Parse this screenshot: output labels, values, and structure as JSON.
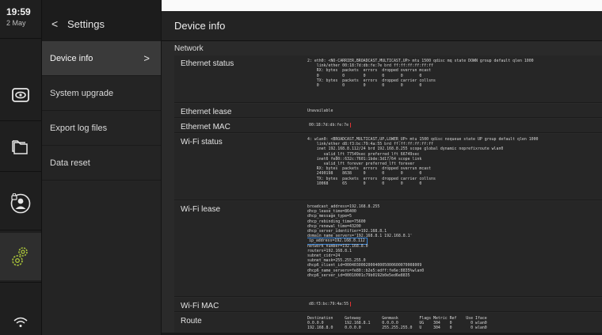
{
  "status": {
    "time": "19:59",
    "date": "2 May"
  },
  "menu": {
    "back_label": "<",
    "title": "Settings",
    "items": [
      {
        "label": "Device info",
        "active": true,
        "chevron": ">"
      },
      {
        "label": "System upgrade"
      },
      {
        "label": "Export log files"
      },
      {
        "label": "Data reset"
      }
    ]
  },
  "main": {
    "title": "Device info",
    "section": "Network",
    "rows": [
      {
        "label": "Ethernet status",
        "lines": [
          "2: eth0: <NO-CARRIER,BROADCAST,MULTICAST,UP> mtu 1500 qdisc mq state DOWN group default qlen 1000",
          "    link/ether 00:18:7d:db:fe:7e brd ff:ff:ff:ff:ff:ff",
          "    RX: bytes  packets  errors  dropped overrun mcast",
          "    0          0        0       0       0       0",
          "    TX: bytes  packets  errors  dropped carrier collsns",
          "    0          0        0       0       0       0"
        ]
      },
      {
        "label": "Ethernet lease",
        "lines": [
          "Unavailable"
        ]
      },
      {
        "label": "Ethernet MAC",
        "lines": [
          "00:18:7d:db:fe:7e"
        ],
        "highlight": "red"
      },
      {
        "label": "Wi-Fi status",
        "lines": [
          "4: wlan0: <BROADCAST,MULTICAST,UP,LOWER_UP> mtu 1500 qdisc noqueue state UP group default qlen 1000",
          "    link/ether d8:f3:bc:79:4a:55 brd ff:ff:ff:ff:ff:ff",
          "    inet 192.168.8.112/24 brd 192.168.8.255 scope global dynamic noprefixroute wlan0",
          "       valid_lft 77549sec preferred_lft 66749sec",
          "    inet6 fe80::632c:7601:1bde:3d17/64 scope link",
          "       valid_lft forever preferred_lft forever",
          "    RX: bytes  packets  errors  dropped overrun mcast",
          "    2490198    8638     0       0       0       0",
          "    TX: bytes  packets  errors  dropped carrier collsns",
          "    10068      65       0       0       0       0"
        ]
      },
      {
        "label": "Wi-Fi lease",
        "lines": [
          "broadcast_address=192.168.8.255",
          "dhcp_lease_time=86400",
          "dhcp_message_type=5",
          "dhcp_rebinding_time=75600",
          "dhcp_renewal_time=43200",
          "dhcp_server_identifier=192.168.8.1",
          "domain_name_servers='192.168.8.1 192.168.8.1'",
          "ip_address=192.168.8.112",
          "network_number=192.168.8.0",
          "routers=192.168.8.1",
          "subnet_cidr=24",
          "subnet_mask=255.255.255.0",
          "dhcp6_client_id=000403000200040005000600070008009",
          "dhcp6_name_servers=fe80::b2e5:edff:fe6e:8835%wlan0",
          "dhcp6_server_id=00010001c79b0192b0e5ed6e8835"
        ],
        "highlight_line": 7
      },
      {
        "label": "Wi-Fi MAC",
        "lines": [
          "d8:f3:bc:79:4a:55"
        ],
        "highlight": "red"
      },
      {
        "label": "Route",
        "lines": [
          "Destination     Gateway         Genmask         Flags Metric Ref    Use Iface",
          "0.0.0.0         192.168.8.1     0.0.0.0         UG    304    0        0 wlan0",
          "192.168.8.0     0.0.0.0         255.255.255.0   U     304    0        0 wlan0"
        ]
      }
    ]
  },
  "colors": {
    "highlight_red": "#d33333",
    "highlight_blue": "#3a86d9",
    "background": "#2a2a2a"
  },
  "rail_icons": [
    "camera-icon",
    "folder-icon",
    "user-lock-icon",
    "gears-icon",
    "wifi-icon"
  ]
}
